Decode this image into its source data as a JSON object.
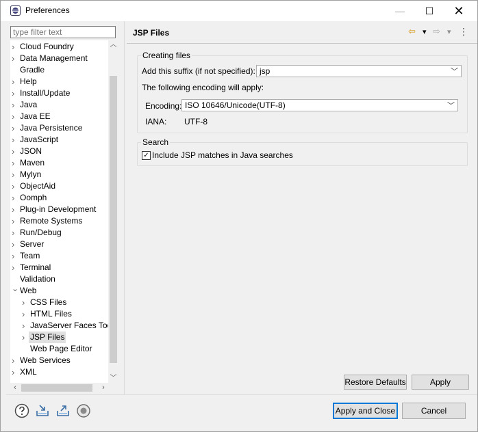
{
  "window": {
    "title": "Preferences",
    "minimize_glyph": "—",
    "maximize_glyph": "☐",
    "close_glyph": "✕"
  },
  "filter": {
    "placeholder": "type filter text"
  },
  "tree": {
    "items": [
      {
        "label": "Cloud Foundry",
        "level": 0,
        "expander": "collapsed"
      },
      {
        "label": "Data Management",
        "level": 0,
        "expander": "collapsed"
      },
      {
        "label": "Gradle",
        "level": 0,
        "expander": "none"
      },
      {
        "label": "Help",
        "level": 0,
        "expander": "collapsed"
      },
      {
        "label": "Install/Update",
        "level": 0,
        "expander": "collapsed"
      },
      {
        "label": "Java",
        "level": 0,
        "expander": "collapsed"
      },
      {
        "label": "Java EE",
        "level": 0,
        "expander": "collapsed"
      },
      {
        "label": "Java Persistence",
        "level": 0,
        "expander": "collapsed"
      },
      {
        "label": "JavaScript",
        "level": 0,
        "expander": "collapsed"
      },
      {
        "label": "JSON",
        "level": 0,
        "expander": "collapsed"
      },
      {
        "label": "Maven",
        "level": 0,
        "expander": "collapsed"
      },
      {
        "label": "Mylyn",
        "level": 0,
        "expander": "collapsed"
      },
      {
        "label": "ObjectAid",
        "level": 0,
        "expander": "collapsed"
      },
      {
        "label": "Oomph",
        "level": 0,
        "expander": "collapsed"
      },
      {
        "label": "Plug-in Development",
        "level": 0,
        "expander": "collapsed"
      },
      {
        "label": "Remote Systems",
        "level": 0,
        "expander": "collapsed"
      },
      {
        "label": "Run/Debug",
        "level": 0,
        "expander": "collapsed"
      },
      {
        "label": "Server",
        "level": 0,
        "expander": "collapsed"
      },
      {
        "label": "Team",
        "level": 0,
        "expander": "collapsed"
      },
      {
        "label": "Terminal",
        "level": 0,
        "expander": "collapsed"
      },
      {
        "label": "Validation",
        "level": 0,
        "expander": "none"
      },
      {
        "label": "Web",
        "level": 0,
        "expander": "expanded"
      },
      {
        "label": "CSS Files",
        "level": 1,
        "expander": "collapsed"
      },
      {
        "label": "HTML Files",
        "level": 1,
        "expander": "collapsed"
      },
      {
        "label": "JavaServer Faces Too",
        "level": 1,
        "expander": "collapsed"
      },
      {
        "label": "JSP Files",
        "level": 1,
        "expander": "collapsed",
        "selected": true
      },
      {
        "label": "Web Page Editor",
        "level": 1,
        "expander": "none"
      },
      {
        "label": "Web Services",
        "level": 0,
        "expander": "collapsed"
      },
      {
        "label": "XML",
        "level": 0,
        "expander": "collapsed"
      }
    ]
  },
  "page": {
    "title": "JSP Files",
    "back_glyph": "⇦",
    "forward_glyph": "⇨",
    "dropdown_glyph": "▾",
    "menu_glyph": "⋮",
    "creating_files": {
      "group_label": "Creating files",
      "suffix_label": "Add this suffix (if not specified):",
      "suffix_value": "jsp",
      "encoding_note": "The following encoding will apply:",
      "encoding_label": "Encoding:",
      "encoding_value": "ISO 10646/Unicode(UTF-8)",
      "iana_label": "IANA:",
      "iana_value": "UTF-8"
    },
    "search": {
      "group_label": "Search",
      "include_label": "Include JSP matches in Java searches",
      "include_checked": true,
      "check_glyph": "✓"
    },
    "restore_defaults": "Restore Defaults",
    "apply": "Apply"
  },
  "footer": {
    "apply_and_close": "Apply and Close",
    "cancel": "Cancel",
    "icons": [
      "help-icon",
      "import-icon",
      "export-icon",
      "record-icon"
    ]
  },
  "colors": {
    "accent": "#0078d7",
    "background": "#f0f0f0"
  }
}
